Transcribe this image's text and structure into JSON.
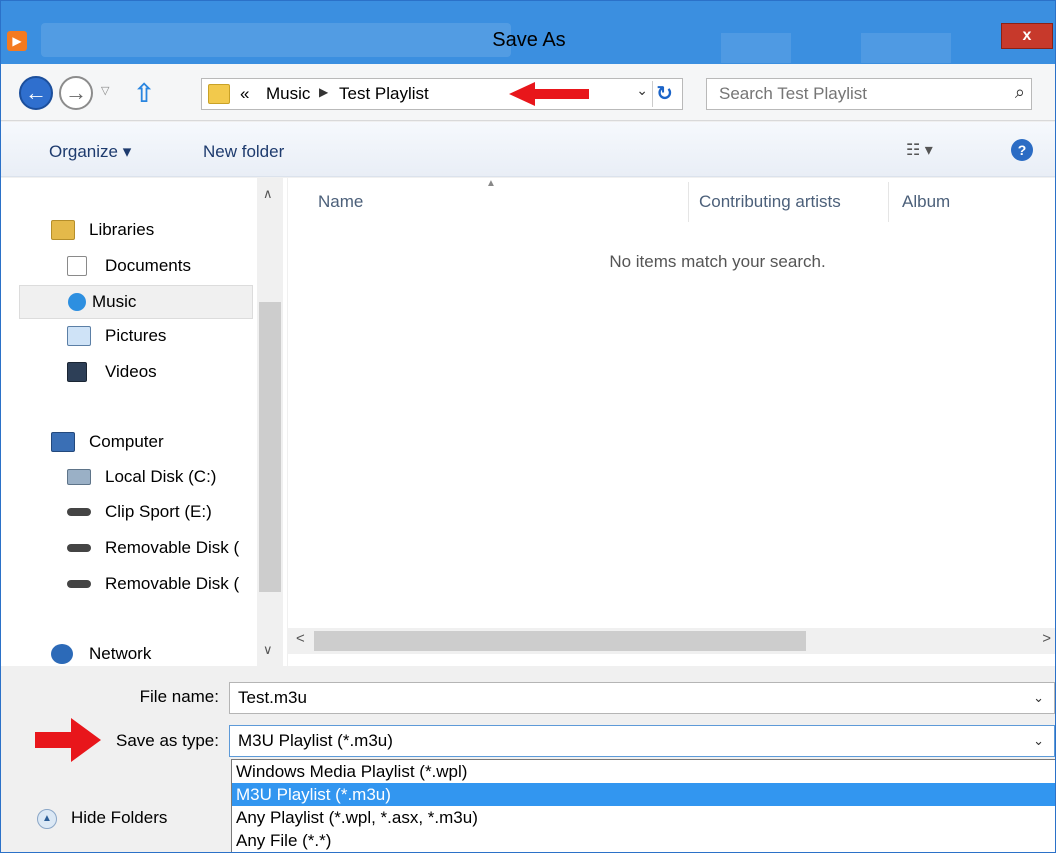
{
  "window": {
    "title": "Save As",
    "close_glyph": "x"
  },
  "address": {
    "overflow": "«",
    "crumbs": [
      "Music",
      "Test Playlist"
    ],
    "search_placeholder": "Search Test Playlist"
  },
  "toolbar": {
    "organize": "Organize ▾",
    "new_folder": "New folder"
  },
  "nav": {
    "libraries": "Libraries",
    "documents": "Documents",
    "music": "Music",
    "pictures": "Pictures",
    "videos": "Videos",
    "computer": "Computer",
    "local_disk": "Local Disk (C:)",
    "clip_sport": "Clip Sport (E:)",
    "removable1": "Removable Disk (",
    "removable2": "Removable Disk (",
    "network": "Network",
    "selected": "Music"
  },
  "content": {
    "columns": [
      "Name",
      "Contributing artists",
      "Album"
    ],
    "empty_message": "No items match your search."
  },
  "form": {
    "file_name_label": "File name:",
    "file_name_value": "Test.m3u",
    "save_type_label": "Save as type:",
    "save_type_value": "M3U Playlist (*.m3u)",
    "type_options": [
      "Windows Media Playlist (*.wpl)",
      "M3U Playlist (*.m3u)",
      "Any Playlist (*.wpl, *.asx, *.m3u)",
      "Any File (*.*)"
    ],
    "selected_option": "M3U Playlist (*.m3u)",
    "hide_folders": "Hide Folders"
  },
  "colors": {
    "titlebar": "#3b8fe0",
    "highlight": "#3296f0",
    "annotation_arrow": "#e8161b"
  }
}
